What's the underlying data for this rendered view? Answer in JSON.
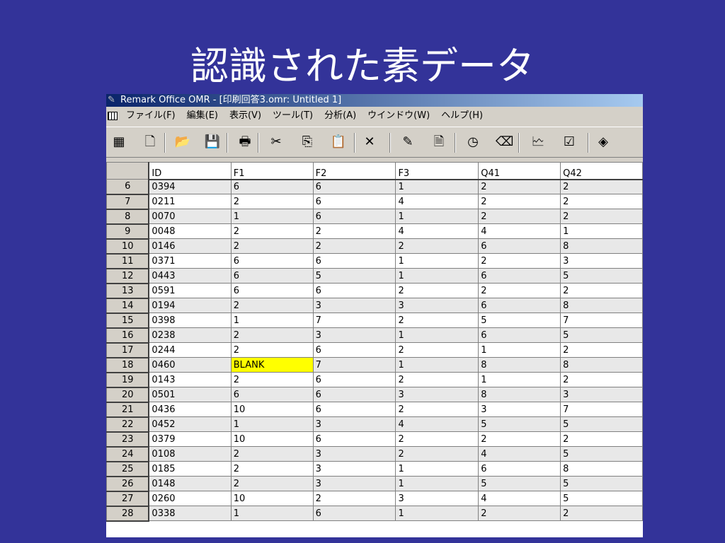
{
  "slide": {
    "title": "認識された素データ"
  },
  "window": {
    "title": "Remark Office OMR - [印刷回答3.omr: Untitled 1]"
  },
  "menu": [
    "ファイル(F)",
    "編集(E)",
    "表示(V)",
    "ツール(T)",
    "分析(A)",
    "ウインドウ(W)",
    "ヘルプ(H)"
  ],
  "toolbar": {
    "buttons": [
      {
        "icon": "grid-view-icon",
        "glyph": "▦"
      },
      {
        "icon": "new-document-icon",
        "glyph": "🗋"
      },
      {
        "icon": "open-folder-icon",
        "glyph": "📂"
      },
      {
        "icon": "save-icon",
        "glyph": "💾"
      },
      {
        "icon": "print-icon",
        "glyph": "🖶"
      },
      {
        "icon": "cut-icon",
        "glyph": "✂"
      },
      {
        "icon": "copy-icon",
        "glyph": "⎘"
      },
      {
        "icon": "paste-icon",
        "glyph": "📋"
      },
      {
        "icon": "delete-icon",
        "glyph": "✕"
      },
      {
        "icon": "scan-icon",
        "glyph": "✎"
      },
      {
        "icon": "page-icon",
        "glyph": "🗎"
      },
      {
        "icon": "clock-icon",
        "glyph": "◷"
      },
      {
        "icon": "eraser-icon",
        "glyph": "⌫"
      },
      {
        "icon": "report-icon",
        "glyph": "🗠"
      },
      {
        "icon": "checklist-icon",
        "glyph": "☑"
      },
      {
        "icon": "help-book-icon",
        "glyph": "◈"
      }
    ]
  },
  "grid": {
    "columns": [
      "ID",
      "F1",
      "F2",
      "F3",
      "Q41",
      "Q42"
    ],
    "rows": [
      {
        "n": "6",
        "cells": [
          "0394",
          "6",
          "6",
          "1",
          "2",
          "2"
        ]
      },
      {
        "n": "7",
        "cells": [
          "0211",
          "2",
          "6",
          "4",
          "2",
          "2"
        ]
      },
      {
        "n": "8",
        "cells": [
          "0070",
          "1",
          "6",
          "1",
          "2",
          "2"
        ]
      },
      {
        "n": "9",
        "cells": [
          "0048",
          "2",
          "2",
          "4",
          "4",
          "1"
        ]
      },
      {
        "n": "10",
        "cells": [
          "0146",
          "2",
          "2",
          "2",
          "6",
          "8"
        ]
      },
      {
        "n": "11",
        "cells": [
          "0371",
          "6",
          "6",
          "1",
          "2",
          "3"
        ]
      },
      {
        "n": "12",
        "cells": [
          "0443",
          "6",
          "5",
          "1",
          "6",
          "5"
        ]
      },
      {
        "n": "13",
        "cells": [
          "0591",
          "6",
          "6",
          "2",
          "2",
          "2"
        ]
      },
      {
        "n": "14",
        "cells": [
          "0194",
          "2",
          "3",
          "3",
          "6",
          "8"
        ]
      },
      {
        "n": "15",
        "cells": [
          "0398",
          "1",
          "7",
          "2",
          "5",
          "7"
        ]
      },
      {
        "n": "16",
        "cells": [
          "0238",
          "2",
          "3",
          "1",
          "6",
          "5"
        ]
      },
      {
        "n": "17",
        "cells": [
          "0244",
          "2",
          "6",
          "2",
          "1",
          "2"
        ]
      },
      {
        "n": "18",
        "cells": [
          "0460",
          "BLANK",
          "7",
          "1",
          "8",
          "8"
        ]
      },
      {
        "n": "19",
        "cells": [
          "0143",
          "2",
          "6",
          "2",
          "1",
          "2"
        ]
      },
      {
        "n": "20",
        "cells": [
          "0501",
          "6",
          "6",
          "3",
          "8",
          "3"
        ]
      },
      {
        "n": "21",
        "cells": [
          "0436",
          "10",
          "6",
          "2",
          "3",
          "7"
        ]
      },
      {
        "n": "22",
        "cells": [
          "0452",
          "1",
          "3",
          "4",
          "5",
          "5"
        ]
      },
      {
        "n": "23",
        "cells": [
          "0379",
          "10",
          "6",
          "2",
          "2",
          "2"
        ]
      },
      {
        "n": "24",
        "cells": [
          "0108",
          "2",
          "3",
          "2",
          "4",
          "5"
        ]
      },
      {
        "n": "25",
        "cells": [
          "0185",
          "2",
          "3",
          "1",
          "6",
          "8"
        ]
      },
      {
        "n": "26",
        "cells": [
          "0148",
          "2",
          "3",
          "1",
          "5",
          "5"
        ]
      },
      {
        "n": "27",
        "cells": [
          "0260",
          "10",
          "2",
          "3",
          "4",
          "5"
        ]
      },
      {
        "n": "28",
        "cells": [
          "0338",
          "1",
          "6",
          "1",
          "2",
          "2"
        ]
      }
    ],
    "highlight_color": "#ffff00"
  }
}
